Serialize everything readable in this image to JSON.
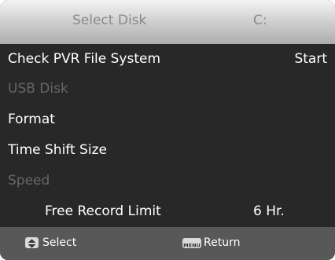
{
  "header": {
    "title": "Select Disk",
    "value": "C:"
  },
  "menu": {
    "items": [
      {
        "label": "Check PVR File System",
        "value": "Start",
        "enabled": true
      },
      {
        "label": "USB Disk",
        "enabled": false
      },
      {
        "label": "Format",
        "enabled": true
      },
      {
        "label": "Time Shift Size",
        "enabled": true
      },
      {
        "label": "Speed",
        "enabled": false
      },
      {
        "label": "Free Record Limit",
        "value": "6 Hr.",
        "enabled": true
      }
    ]
  },
  "footer": {
    "select_icon": "up-down-arrows-icon",
    "select_label": "Select",
    "menu_icon_text": "MENU",
    "return_label": "Return"
  },
  "colors": {
    "background": "#262626",
    "header": "#c8c8c8",
    "footer": "#585858",
    "disabled_text": "#666666"
  }
}
